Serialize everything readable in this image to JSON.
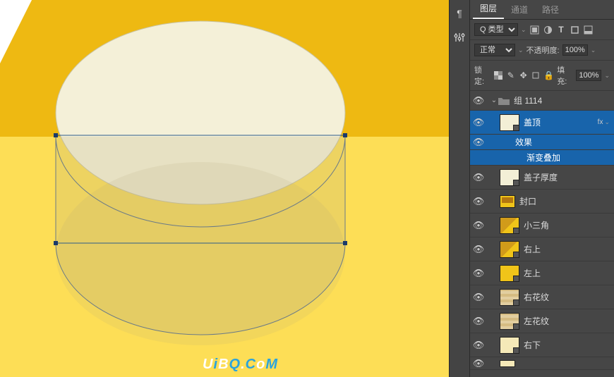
{
  "panel": {
    "tabs": {
      "layers": "图层",
      "channels": "通道",
      "paths": "路径"
    },
    "filter_kind": "Q 类型",
    "blend_mode": "正常",
    "opacity_label": "不透明度:",
    "opacity_value": "100%",
    "lock_label": "锁定:",
    "fill_label": "填充:",
    "fill_value": "100%",
    "effects_label": "效果",
    "gradient_overlay": "渐变叠加",
    "fx": "fx"
  },
  "group": {
    "name": "组 1114"
  },
  "layers": [
    {
      "name": "盖顶",
      "thumb": "thumb-cream",
      "selected": true,
      "fx": true
    },
    {
      "name": "盖子厚度",
      "thumb": "thumb-cream"
    },
    {
      "name": "封口",
      "thumb": "thumb-seal"
    },
    {
      "name": "小三角",
      "thumb": "thumb-half"
    },
    {
      "name": "右上",
      "thumb": "thumb-half"
    },
    {
      "name": "左上",
      "thumb": "thumb-yellow"
    },
    {
      "name": "右花纹",
      "thumb": "thumb-pattern"
    },
    {
      "name": "左花纹",
      "thumb": "thumb-pattern"
    },
    {
      "name": "右下",
      "thumb": "thumb-light"
    }
  ],
  "watermark": "UiBQ.CoM"
}
